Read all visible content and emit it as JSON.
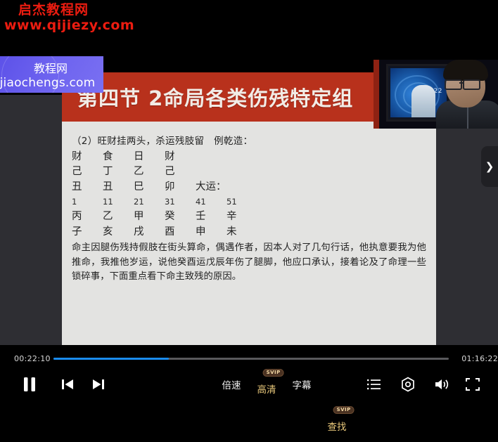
{
  "player": {
    "time_current": "00:22:10",
    "time_total": "01:16:22",
    "progress_percent": 28.8,
    "progress_color": "#1a8cf0"
  },
  "controls": {
    "pause_label": "pause-icon",
    "prev_label": "previous-icon",
    "next_label": "next-icon",
    "speed_label": "倍速",
    "quality_label": "高清",
    "subtitle_label": "字幕",
    "search_label": "查找",
    "badge_label": "SVIP",
    "playlist_label": "playlist-icon",
    "settings_label": "settings-icon",
    "volume_label": "volume-icon",
    "fullscreen_label": "fullscreen-icon",
    "gold_color": "#e8c77a"
  },
  "slide": {
    "title": "第四节 2命局各类伤残特定组",
    "title_bg": "#b8311c",
    "body_bg": "#e3e3e1",
    "heading": "（2）旺财挂两头，杀运残肢留　例乾造：",
    "pillars": {
      "gods": [
        "财",
        "食",
        "日",
        "财"
      ],
      "stems": [
        "己",
        "丁",
        "乙",
        "己"
      ],
      "branches": [
        "丑",
        "丑",
        "巳",
        "卯"
      ],
      "branches_suffix": "大运："
    },
    "luck": {
      "ages": [
        "1",
        "11",
        "21",
        "31",
        "41",
        "51"
      ],
      "stems": [
        "丙",
        "乙",
        "甲",
        "癸",
        "壬",
        "辛"
      ],
      "branches": [
        "子",
        "亥",
        "戌",
        "酉",
        "申",
        "未"
      ]
    },
    "paragraph": "命主因腿伤残持假肢在街头算命，偶遇作者，因本人对了几句行话，他执意要我为他推命，我推他岁运，说他癸酉运戊辰年伤了腿脚，他应口承认，接着论及了命理一些锁碎事，下面重点看下命主致残的原因。"
  },
  "watermarks": {
    "red_line1": "启杰教程网",
    "red_line2": "www.qijiezy.com",
    "red_color": "#ec1c10",
    "blue_line1": "教程网",
    "blue_line2": ".jiaochengs.com",
    "blue_color": "#6d63ef"
  },
  "webcam": {
    "tv_time": "20:22"
  },
  "sidebar": {
    "expand_label": "❯"
  }
}
